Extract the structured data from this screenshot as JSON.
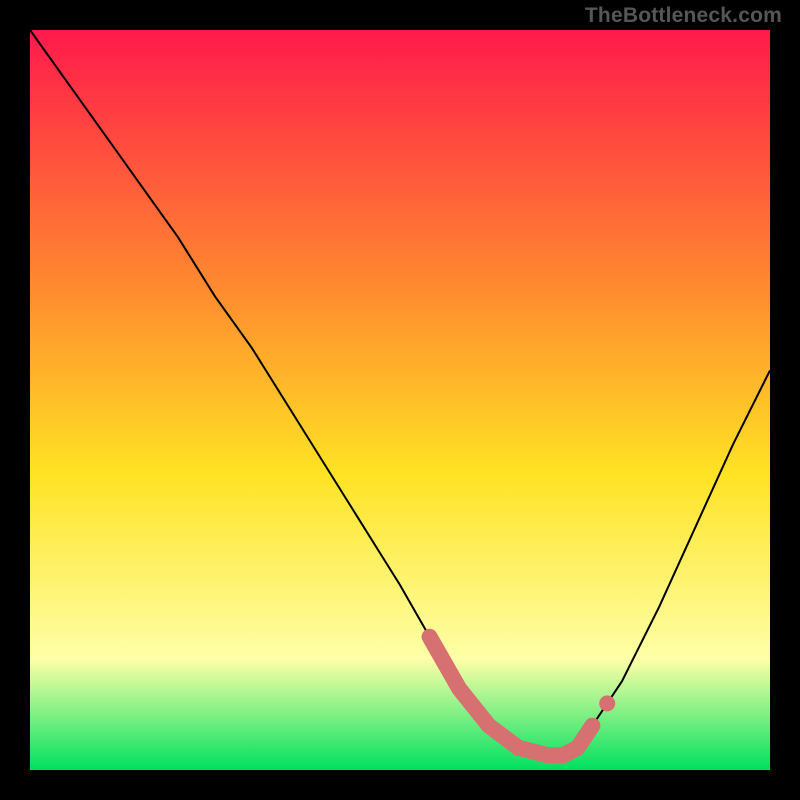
{
  "watermark": "TheBottleneck.com",
  "chart_data": {
    "type": "line",
    "title": "",
    "xlabel": "",
    "ylabel": "",
    "xlim": [
      0,
      100
    ],
    "ylim": [
      0,
      100
    ],
    "colors": {
      "gradient_top": "#ff1a4b",
      "gradient_mid_upper": "#ff8b2f",
      "gradient_mid": "#ffe324",
      "gradient_lower": "#feffa8",
      "gradient_bottom": "#00e060",
      "frame": "#000000",
      "curve": "#000000",
      "highlight": "#d77070"
    },
    "series": [
      {
        "name": "bottleneck-curve",
        "x": [
          0,
          5,
          10,
          15,
          20,
          25,
          30,
          35,
          40,
          45,
          50,
          54,
          58,
          62,
          66,
          70,
          72,
          74,
          76,
          80,
          85,
          90,
          95,
          100
        ],
        "y": [
          100,
          93,
          86,
          79,
          72,
          64,
          57,
          49,
          41,
          33,
          25,
          18,
          11,
          6,
          3,
          2,
          2,
          3,
          6,
          12,
          22,
          33,
          44,
          54
        ]
      }
    ],
    "highlight_segment": {
      "x": [
        54,
        58,
        62,
        66,
        70,
        72,
        74,
        76
      ],
      "y": [
        18,
        11,
        6,
        3,
        2,
        2,
        3,
        6
      ],
      "style": "thick-rounded"
    },
    "highlight_dot": {
      "x": 78,
      "y": 9
    }
  }
}
